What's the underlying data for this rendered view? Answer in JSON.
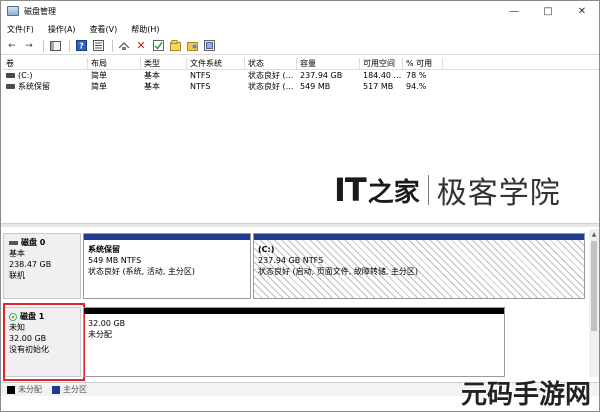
{
  "window": {
    "title": "磁盘管理"
  },
  "menu": [
    "文件(F)",
    "操作(A)",
    "查看(V)",
    "帮助(H)"
  ],
  "volume_list": {
    "columns": [
      "卷",
      "布局",
      "类型",
      "文件系统",
      "状态",
      "容量",
      "可用空间",
      "% 可用"
    ],
    "rows": [
      [
        "(C:)",
        "简单",
        "基本",
        "NTFS",
        "状态良好 (...",
        "237.94 GB",
        "184.40 ...",
        "78 %"
      ],
      [
        "系统保留",
        "简单",
        "基本",
        "NTFS",
        "状态良好 (...",
        "549 MB",
        "517 MB",
        "94.%"
      ]
    ]
  },
  "logo": {
    "it": "IT",
    "ink": "之家",
    "text": "极客学院"
  },
  "disks": [
    {
      "name": "磁盘 0",
      "type": "基本",
      "size": "238.47 GB",
      "status": "联机",
      "partitions": [
        {
          "name": "系统保留",
          "size": "549 MB NTFS",
          "status": "状态良好 (系统, 活动, 主分区)"
        },
        {
          "name": "(C:)",
          "size": "237.94 GB NTFS",
          "status": "状态良好 (启动, 页面文件, 故障转储, 主分区)"
        }
      ]
    },
    {
      "name": "磁盘 1",
      "type": "未知",
      "size": "32.00 GB",
      "status": "没有初始化",
      "partitions": [
        {
          "name": "",
          "size": "32.00 GB",
          "status": "未分配"
        }
      ]
    }
  ],
  "legend": [
    {
      "label": "未分配",
      "color": "#000000"
    },
    {
      "label": "主分区",
      "color": "#1f3a8f"
    }
  ],
  "site_watermark": "元码手游网",
  "colors": {
    "primary_bar": "#1f3a8f",
    "unallocated_bar": "#000000",
    "highlight": "#e0262a"
  }
}
